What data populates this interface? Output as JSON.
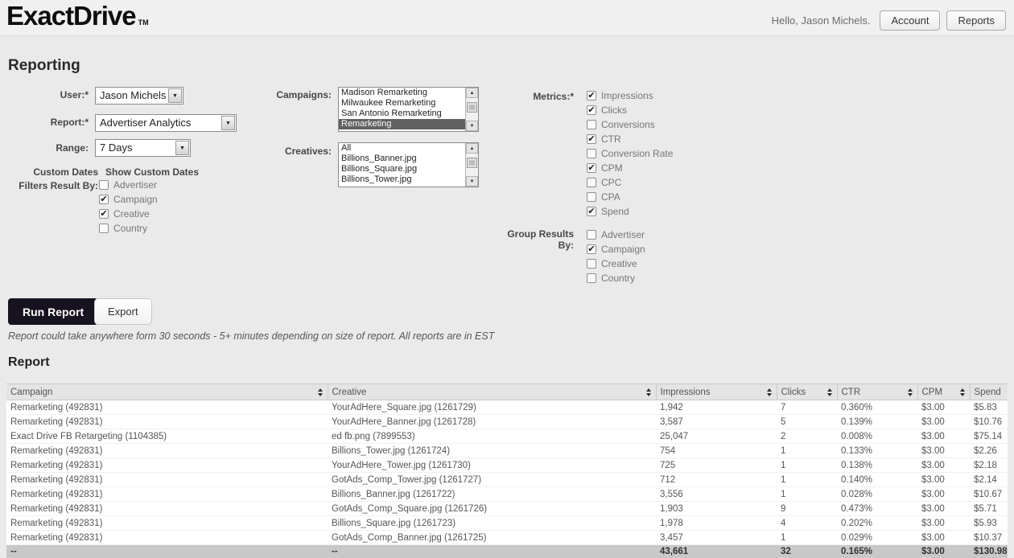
{
  "header": {
    "logo": "ExactDrive",
    "logo_tm": "TM",
    "greeting": "Hello, Jason Michels.",
    "account_button": "Account",
    "reports_button": "Reports"
  },
  "reporting": {
    "title": "Reporting",
    "user_label": "User:*",
    "user_value": "Jason Michels",
    "report_label": "Report:*",
    "report_value": "Advertiser Analytics",
    "range_label": "Range:",
    "range_value": "7 Days",
    "custom_dates_label": "Custom Dates",
    "show_custom_dates_label": "Show Custom Dates",
    "filters_label": "Filters Result By:",
    "filters": [
      {
        "label": "Advertiser",
        "checked": false
      },
      {
        "label": "Campaign",
        "checked": true
      },
      {
        "label": "Creative",
        "checked": true
      },
      {
        "label": "Country",
        "checked": false
      }
    ],
    "campaigns_label": "Campaigns:",
    "campaigns": {
      "items": [
        "Madison Remarketing",
        "Milwaukee Remarketing",
        "San Antonio Remarketing",
        "Remarketing"
      ],
      "selected": "Remarketing"
    },
    "creatives_label": "Creatives:",
    "creatives": {
      "items": [
        "All",
        "Billions_Banner.jpg",
        "Billions_Square.jpg",
        "Billions_Tower.jpg"
      ],
      "selected": ""
    },
    "metrics_label": "Metrics:*",
    "metrics": [
      {
        "label": "Impressions",
        "checked": true
      },
      {
        "label": "Clicks",
        "checked": true
      },
      {
        "label": "Conversions",
        "checked": false
      },
      {
        "label": "CTR",
        "checked": true
      },
      {
        "label": "Conversion Rate",
        "checked": false
      },
      {
        "label": "CPM",
        "checked": true
      },
      {
        "label": "CPC",
        "checked": false
      },
      {
        "label": "CPA",
        "checked": false
      },
      {
        "label": "Spend",
        "checked": true
      }
    ],
    "group_label_line1": "Group Results",
    "group_label_line2": "By:",
    "group_by": [
      {
        "label": "Advertiser",
        "checked": false
      },
      {
        "label": "Campaign",
        "checked": true
      },
      {
        "label": "Creative",
        "checked": false
      },
      {
        "label": "Country",
        "checked": false
      }
    ],
    "run_button": "Run Report",
    "export_button": "Export",
    "note": "Report could take anywhere form 30 seconds - 5+ minutes depending on size of report. All reports are in EST"
  },
  "report_table": {
    "title": "Report",
    "columns": [
      {
        "label": "Campaign",
        "sortable": true
      },
      {
        "label": "Creative",
        "sortable": true
      },
      {
        "label": "Impressions",
        "sortable": true
      },
      {
        "label": "Clicks",
        "sortable": true
      },
      {
        "label": "CTR",
        "sortable": true
      },
      {
        "label": "CPM",
        "sortable": true
      },
      {
        "label": "Spend",
        "sortable": false
      }
    ],
    "rows": [
      [
        "Remarketing (492831)",
        "YourAdHere_Square.jpg (1261729)",
        "1,942",
        "7",
        "0.360%",
        "$3.00",
        "$5.83"
      ],
      [
        "Remarketing (492831)",
        "YourAdHere_Banner.jpg (1261728)",
        "3,587",
        "5",
        "0.139%",
        "$3.00",
        "$10.76"
      ],
      [
        "Exact Drive FB Retargeting (1104385)",
        "ed fb.png (7899553)",
        "25,047",
        "2",
        "0.008%",
        "$3.00",
        "$75.14"
      ],
      [
        "Remarketing (492831)",
        "Billions_Tower.jpg (1261724)",
        "754",
        "1",
        "0.133%",
        "$3.00",
        "$2.26"
      ],
      [
        "Remarketing (492831)",
        "YourAdHere_Tower.jpg (1261730)",
        "725",
        "1",
        "0.138%",
        "$3.00",
        "$2.18"
      ],
      [
        "Remarketing (492831)",
        "GotAds_Comp_Tower.jpg (1261727)",
        "712",
        "1",
        "0.140%",
        "$3.00",
        "$2.14"
      ],
      [
        "Remarketing (492831)",
        "Billions_Banner.jpg (1261722)",
        "3,556",
        "1",
        "0.028%",
        "$3.00",
        "$10.67"
      ],
      [
        "Remarketing (492831)",
        "GotAds_Comp_Square.jpg (1261726)",
        "1,903",
        "9",
        "0.473%",
        "$3.00",
        "$5.71"
      ],
      [
        "Remarketing (492831)",
        "Billions_Square.jpg (1261723)",
        "1,978",
        "4",
        "0.202%",
        "$3.00",
        "$5.93"
      ],
      [
        "Remarketing (492831)",
        "GotAds_Comp_Banner.jpg (1261725)",
        "3,457",
        "1",
        "0.029%",
        "$3.00",
        "$10.37"
      ]
    ],
    "totals": [
      "--",
      "--",
      "43,661",
      "32",
      "0.165%",
      "$3.00",
      "$130.98"
    ]
  },
  "colors": {
    "page_bg": "#eaeaea",
    "run_button_bg": "#17121f",
    "list_selected_bg": "#616161",
    "table_header_bg": "#e4e4e4",
    "totals_row_bg": "#c8c8c8"
  }
}
